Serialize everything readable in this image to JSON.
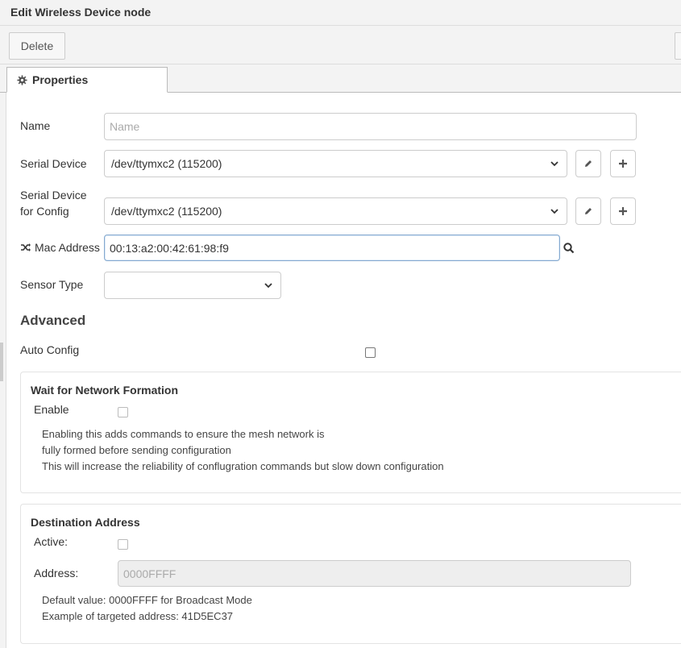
{
  "header": {
    "title": "Edit Wireless Device node"
  },
  "toolbar": {
    "delete_label": "Delete"
  },
  "tabs": [
    {
      "label": "Properties",
      "icon": "gear-icon"
    }
  ],
  "form": {
    "name": {
      "label": "Name",
      "placeholder": "Name",
      "value": ""
    },
    "serial_device": {
      "label": "Serial Device",
      "value": "/dev/ttymxc2 (115200)"
    },
    "serial_device_config": {
      "label_line1": "Serial Device",
      "label_line2": "for Config",
      "value": "/dev/ttymxc2 (115200)"
    },
    "mac_address": {
      "label": "Mac Address",
      "value": "00:13:a2:00:42:61:98:f9"
    },
    "sensor_type": {
      "label": "Sensor Type",
      "value": ""
    }
  },
  "advanced": {
    "title": "Advanced",
    "auto_config": {
      "label": "Auto Config",
      "checked": false
    }
  },
  "network_formation": {
    "title": "Wait for Network Formation",
    "enable_label": "Enable",
    "help": [
      "Enabling this adds commands to ensure the mesh network is",
      "fully formed before sending configuration",
      "This will increase the reliability of conflugration commands but slow down configuration"
    ]
  },
  "destination": {
    "title": "Destination Address",
    "active_label": "Active:",
    "address_label": "Address:",
    "address_placeholder": "0000FFFF",
    "help": [
      "Default value: 0000FFFF for Broadcast Mode",
      "Example of targeted address: 41D5EC37"
    ]
  }
}
